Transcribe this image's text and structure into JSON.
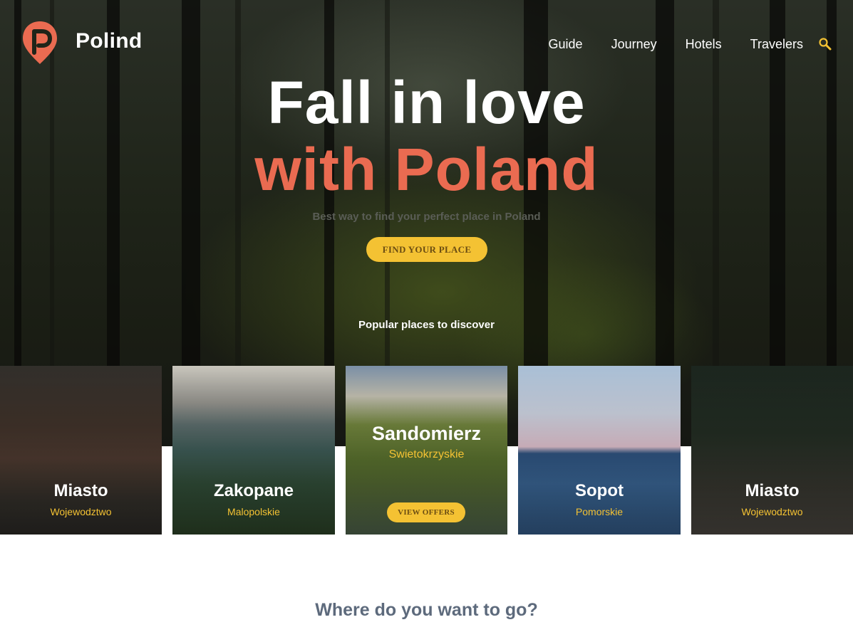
{
  "brand": {
    "name": "Polind",
    "accent": "#ea6b51"
  },
  "nav": {
    "items": [
      {
        "label": "Guide"
      },
      {
        "label": "Journey"
      },
      {
        "label": "Hotels"
      },
      {
        "label": "Travelers"
      }
    ],
    "search_icon": "search-icon"
  },
  "hero": {
    "title_line1": "Fall in love",
    "title_line2": "with Poland",
    "subtitle": "Best way to find your perfect place in Poland",
    "cta_label": "FIND YOUR PLACE",
    "popular_label": "Popular places to discover"
  },
  "cards": [
    {
      "name": "Miasto",
      "region": "Wojewodztwo"
    },
    {
      "name": "Zakopane",
      "region": "Malopolskie"
    },
    {
      "name": "Sandomierz",
      "region": "Swietokrzyskie",
      "button": "VIEW OFFERS"
    },
    {
      "name": "Sopot",
      "region": "Pomorskie"
    },
    {
      "name": "Miasto",
      "region": "Wojewodztwo"
    }
  ],
  "section": {
    "title": "Where do you want to go?"
  },
  "colors": {
    "accent": "#ea6b51",
    "button": "#f4c233",
    "heading": "#5d6a7c"
  }
}
